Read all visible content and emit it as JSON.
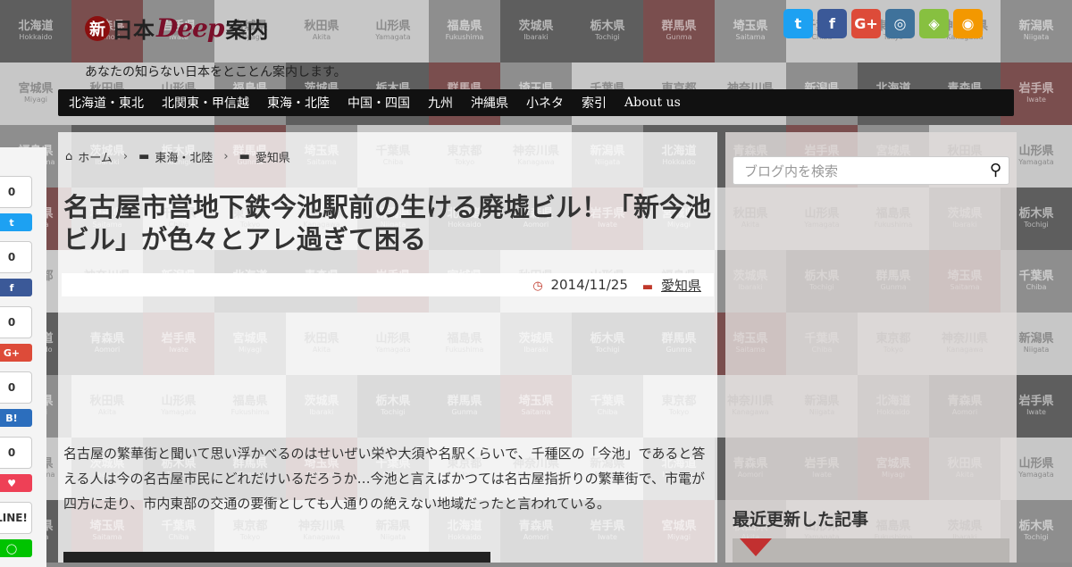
{
  "site": {
    "logo_prefix": "新",
    "logo_middle": "日本",
    "logo_deep": "Deep",
    "logo_suffix": "案内",
    "tagline": "あなたの知らない日本をとことん案内します。"
  },
  "social": [
    {
      "name": "twitter",
      "glyph": "t",
      "color": "#1da1f2"
    },
    {
      "name": "facebook",
      "glyph": "f",
      "color": "#3b5998"
    },
    {
      "name": "google-plus",
      "glyph": "G+",
      "color": "#dd4b39"
    },
    {
      "name": "instagram",
      "glyph": "◎",
      "color": "#3f729b"
    },
    {
      "name": "feedly",
      "glyph": "◈",
      "color": "#87c040"
    },
    {
      "name": "rss",
      "glyph": "◉",
      "color": "#f39800"
    }
  ],
  "nav": [
    "北海道・東北",
    "北関東・甲信越",
    "東海・北陸",
    "中国・四国",
    "九州",
    "沖縄県",
    "小ネタ",
    "索引",
    "About us"
  ],
  "breadcrumb": {
    "home": "ホーム",
    "cat1": "東海・北陸",
    "cat2": "愛知県"
  },
  "article": {
    "title": "名古屋市営地下鉄今池駅前の生ける廃墟ビル！「新今池ビル」が色々とアレ過ぎて困る",
    "date": "2014/11/25",
    "category": "愛知県",
    "body": "名古屋の繁華街と聞いて思い浮かべるのはせいぜい栄や大須や名駅くらいで、千種区の「今池」であると答える人は今の名古屋市民にどれだけいるだろうか…今池と言えばかつては名古屋指折りの繁華街で、市電が四方に走り、市内東部の交通の要衝としても人通りの絶えない地域だったと言われている。"
  },
  "share_buttons": [
    {
      "count": "0",
      "label": "t",
      "color": "#1da1f2"
    },
    {
      "count": "0",
      "label": "f",
      "color": "#3b5998"
    },
    {
      "count": "0",
      "label": "G+",
      "color": "#dd4b39"
    },
    {
      "count": "0",
      "label": "B!",
      "color": "#2c6ebd"
    },
    {
      "count": "0",
      "label": "♥",
      "color": "#ee4056"
    },
    {
      "count": "LINE!",
      "label": "◯",
      "color": "#00c300"
    }
  ],
  "sidebar": {
    "search_placeholder": "ブログ内を検索",
    "recent_heading": "最近更新した記事"
  },
  "tiles": [
    {
      "kanji": "北海道",
      "roman": "Hokkaido"
    },
    {
      "kanji": "青森県",
      "roman": "Aomori"
    },
    {
      "kanji": "岩手県",
      "roman": "Iwate"
    },
    {
      "kanji": "宮城県",
      "roman": "Miyagi"
    },
    {
      "kanji": "秋田県",
      "roman": "Akita"
    },
    {
      "kanji": "山形県",
      "roman": "Yamagata"
    },
    {
      "kanji": "福島県",
      "roman": "Fukushima"
    },
    {
      "kanji": "茨城県",
      "roman": "Ibaraki"
    },
    {
      "kanji": "栃木県",
      "roman": "Tochigi"
    },
    {
      "kanji": "群馬県",
      "roman": "Gunma"
    },
    {
      "kanji": "埼玉県",
      "roman": "Saitama"
    },
    {
      "kanji": "千葉県",
      "roman": "Chiba"
    },
    {
      "kanji": "東京都",
      "roman": "Tokyo"
    },
    {
      "kanji": "神奈川県",
      "roman": "Kanagawa"
    },
    {
      "kanji": "新潟県",
      "roman": "Niigata"
    }
  ]
}
